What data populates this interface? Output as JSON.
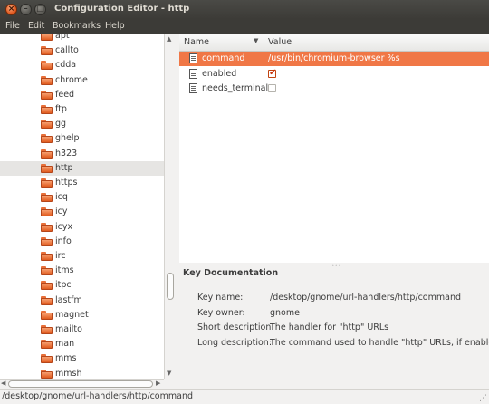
{
  "window": {
    "title": "Configuration Editor - http",
    "close_glyph": "×",
    "minimize_glyph": "–",
    "maximize_glyph": "□"
  },
  "menu": [
    "File",
    "Edit",
    "Bookmarks",
    "Help"
  ],
  "tree": {
    "items": [
      {
        "label": "apt",
        "selected": false
      },
      {
        "label": "callto",
        "selected": false
      },
      {
        "label": "cdda",
        "selected": false
      },
      {
        "label": "chrome",
        "selected": false
      },
      {
        "label": "feed",
        "selected": false
      },
      {
        "label": "ftp",
        "selected": false
      },
      {
        "label": "gg",
        "selected": false
      },
      {
        "label": "ghelp",
        "selected": false
      },
      {
        "label": "h323",
        "selected": false
      },
      {
        "label": "http",
        "selected": true
      },
      {
        "label": "https",
        "selected": false
      },
      {
        "label": "icq",
        "selected": false
      },
      {
        "label": "icy",
        "selected": false
      },
      {
        "label": "icyx",
        "selected": false
      },
      {
        "label": "info",
        "selected": false
      },
      {
        "label": "irc",
        "selected": false
      },
      {
        "label": "itms",
        "selected": false
      },
      {
        "label": "itpc",
        "selected": false
      },
      {
        "label": "lastfm",
        "selected": false
      },
      {
        "label": "magnet",
        "selected": false
      },
      {
        "label": "mailto",
        "selected": false
      },
      {
        "label": "man",
        "selected": false
      },
      {
        "label": "mms",
        "selected": false
      },
      {
        "label": "mmsh",
        "selected": false
      }
    ]
  },
  "keys": {
    "headers": {
      "name": "Name",
      "value": "Value"
    },
    "rows": [
      {
        "name": "command",
        "value": "/usr/bin/chromium-browser %s",
        "type": "text",
        "selected": true
      },
      {
        "name": "enabled",
        "value": "",
        "type": "bool",
        "checked": true,
        "selected": false
      },
      {
        "name": "needs_terminal",
        "value": "",
        "type": "bool",
        "checked": false,
        "selected": false
      }
    ]
  },
  "doc": {
    "title": "Key Documentation",
    "fields": [
      {
        "label": "Key name:",
        "value": "/desktop/gnome/url-handlers/http/command"
      },
      {
        "label": "Key owner:",
        "value": "gnome"
      },
      {
        "label": "Short description:",
        "value": "The handler for \"http\" URLs"
      },
      {
        "label": "Long description:",
        "value": "The command used to handle \"http\" URLs, if enabled."
      }
    ]
  },
  "status": "/desktop/gnome/url-handlers/http/command",
  "colors": {
    "accent": "#f07746",
    "titlebar": "#3c3b37",
    "check": "#c8350e"
  }
}
